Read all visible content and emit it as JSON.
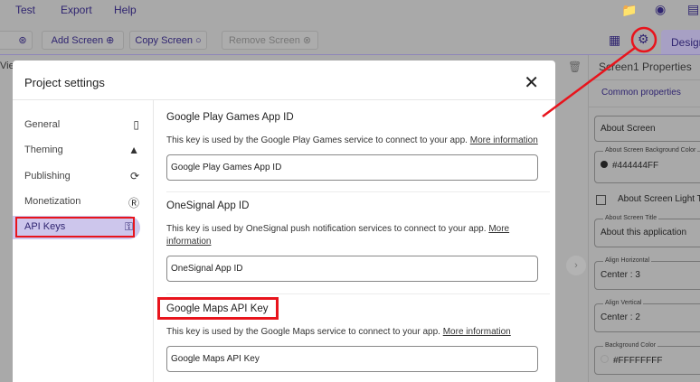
{
  "menu": [
    "Test",
    "Export",
    "Help"
  ],
  "toolbar": {
    "add_screen": "Add Screen",
    "copy_screen": "Copy Screen",
    "remove_screen": "Remove Screen",
    "design": "Designer",
    "viewer_partial": "Vie"
  },
  "properties": {
    "title": "Screen1 Properties",
    "tab": "Common properties",
    "about_screen": "About Screen",
    "bg_label": "About Screen Background Color",
    "bg_value": "#444444FF",
    "light_theme": "About Screen Light Theme",
    "title_label": "About Screen Title",
    "title_value": "About this application",
    "ah_label": "Align Horizontal",
    "ah_value": "Center : 3",
    "av_label": "Align Vertical",
    "av_value": "Center : 2",
    "bgc_label": "Background Color",
    "bgc_value": "#FFFFFFFF"
  },
  "modal": {
    "title": "Project settings",
    "sidebar": [
      {
        "label": "General",
        "icon": "phone-settings-icon"
      },
      {
        "label": "Theming",
        "icon": "drop-icon"
      },
      {
        "label": "Publishing",
        "icon": "sync-icon"
      },
      {
        "label": "Monetization",
        "icon": "dollar-icon"
      },
      {
        "label": "API Keys",
        "icon": "key-icon",
        "active": true
      }
    ],
    "sections": [
      {
        "title": "Google Play Games App ID",
        "desc": "This key is used by the Google Play Games service to connect to your app.",
        "link": "More information",
        "placeholder": "Google Play Games App ID"
      },
      {
        "title": "OneSignal App ID",
        "desc": "This key is used by OneSignal push notification services to connect to your app.",
        "link": "More information",
        "placeholder": "OneSignal App ID"
      },
      {
        "title": "Google Maps API Key",
        "desc": "This key is used by the Google Maps service to connect to your app.",
        "link": "More information",
        "placeholder": "Google Maps API Key"
      }
    ]
  },
  "colors": {
    "accent": "#2f2470",
    "highlight": "#e8141c",
    "active_bg": "#cdc6ec"
  }
}
